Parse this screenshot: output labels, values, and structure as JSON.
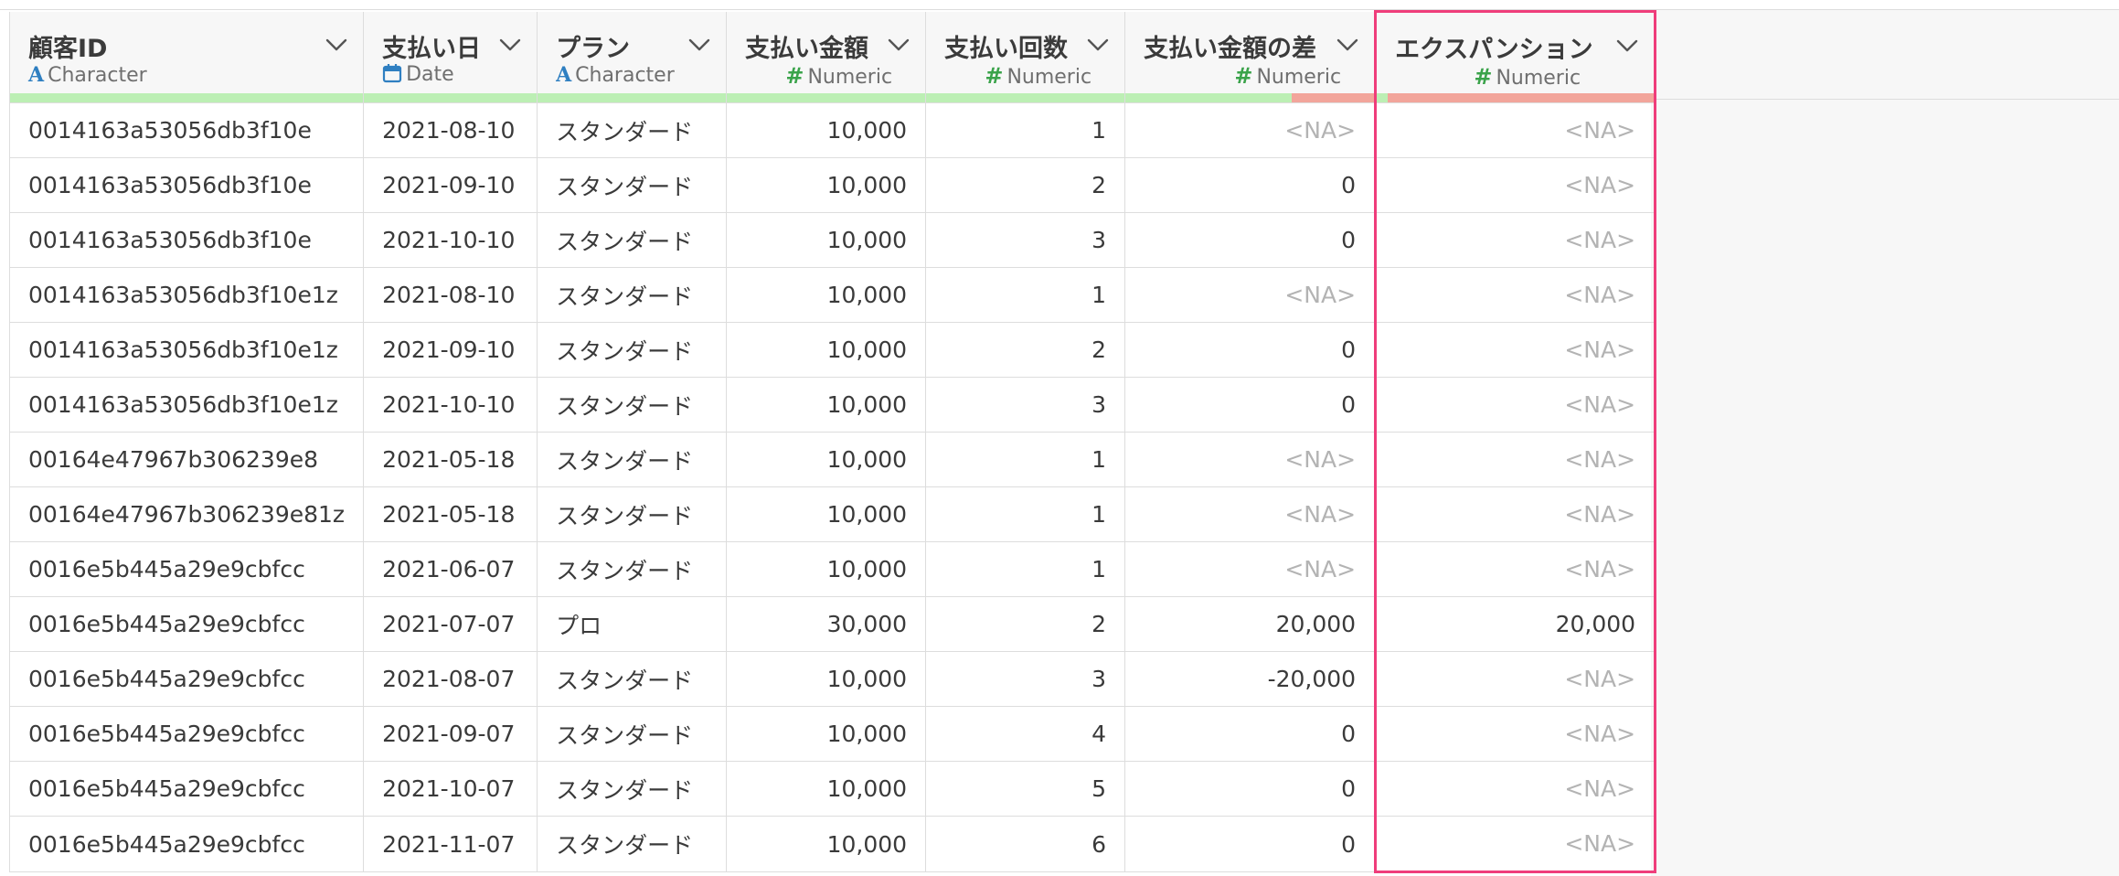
{
  "columns": [
    {
      "name": "顧客ID",
      "type": "Character",
      "type_icon": "character-icon",
      "quality": {
        "valid": 1.0,
        "missing": 0.0
      }
    },
    {
      "name": "支払い日",
      "type": "Date",
      "type_icon": "calendar-icon",
      "quality": {
        "valid": 1.0,
        "missing": 0.0
      }
    },
    {
      "name": "プラン",
      "type": "Character",
      "type_icon": "character-icon",
      "quality": {
        "valid": 1.0,
        "missing": 0.0
      }
    },
    {
      "name": "支払い金額",
      "type": "Numeric",
      "type_icon": "numeric-hash-icon",
      "quality": {
        "valid": 1.0,
        "missing": 0.0
      }
    },
    {
      "name": "支払い回数",
      "type": "Numeric",
      "type_icon": "numeric-hash-icon",
      "quality": {
        "valid": 1.0,
        "missing": 0.0
      }
    },
    {
      "name": "支払い金額の差",
      "type": "Numeric",
      "type_icon": "numeric-hash-icon",
      "quality": {
        "valid": 0.67,
        "missing": 0.33
      }
    },
    {
      "name": "エクスパンション",
      "type": "Numeric",
      "type_icon": "numeric-hash-icon",
      "quality": {
        "valid": 0.04,
        "missing": 0.96
      },
      "highlighted": true
    }
  ],
  "rows": [
    [
      "0014163a53056db3f10e",
      "2021-08-10",
      "スタンダード",
      "10,000",
      "1",
      "<NA>",
      "<NA>"
    ],
    [
      "0014163a53056db3f10e",
      "2021-09-10",
      "スタンダード",
      "10,000",
      "2",
      "0",
      "<NA>"
    ],
    [
      "0014163a53056db3f10e",
      "2021-10-10",
      "スタンダード",
      "10,000",
      "3",
      "0",
      "<NA>"
    ],
    [
      "0014163a53056db3f10e1z",
      "2021-08-10",
      "スタンダード",
      "10,000",
      "1",
      "<NA>",
      "<NA>"
    ],
    [
      "0014163a53056db3f10e1z",
      "2021-09-10",
      "スタンダード",
      "10,000",
      "2",
      "0",
      "<NA>"
    ],
    [
      "0014163a53056db3f10e1z",
      "2021-10-10",
      "スタンダード",
      "10,000",
      "3",
      "0",
      "<NA>"
    ],
    [
      "00164e47967b306239e8",
      "2021-05-18",
      "スタンダード",
      "10,000",
      "1",
      "<NA>",
      "<NA>"
    ],
    [
      "00164e47967b306239e81z",
      "2021-05-18",
      "スタンダード",
      "10,000",
      "1",
      "<NA>",
      "<NA>"
    ],
    [
      "0016e5b445a29e9cbfcc",
      "2021-06-07",
      "スタンダード",
      "10,000",
      "1",
      "<NA>",
      "<NA>"
    ],
    [
      "0016e5b445a29e9cbfcc",
      "2021-07-07",
      "プロ",
      "30,000",
      "2",
      "20,000",
      "20,000"
    ],
    [
      "0016e5b445a29e9cbfcc",
      "2021-08-07",
      "スタンダード",
      "10,000",
      "3",
      "-20,000",
      "<NA>"
    ],
    [
      "0016e5b445a29e9cbfcc",
      "2021-09-07",
      "スタンダード",
      "10,000",
      "4",
      "0",
      "<NA>"
    ],
    [
      "0016e5b445a29e9cbfcc",
      "2021-10-07",
      "スタンダード",
      "10,000",
      "5",
      "0",
      "<NA>"
    ],
    [
      "0016e5b445a29e9cbfcc",
      "2021-11-07",
      "スタンダード",
      "10,000",
      "6",
      "0",
      "<NA>"
    ]
  ],
  "colors": {
    "valid_bar": "#bcefb4",
    "missing_bar": "#f2a59b",
    "highlight_border": "#ef3d7b",
    "character_icon": "#2f7fc1",
    "numeric_icon": "#3aa34a",
    "na_text": "#b3b3b3"
  }
}
